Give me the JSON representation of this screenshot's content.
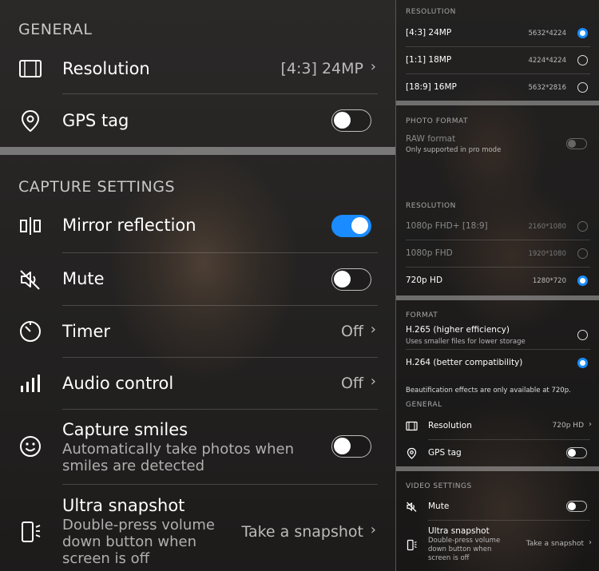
{
  "left": {
    "general_header": "GENERAL",
    "resolution": {
      "title": "Resolution",
      "value": "[4:3] 24MP",
      "chevron": "›"
    },
    "gps": {
      "title": "GPS tag",
      "on": false
    },
    "capture_header": "CAPTURE SETTINGS",
    "mirror": {
      "title": "Mirror reflection",
      "on": true
    },
    "mute": {
      "title": "Mute",
      "on": false
    },
    "timer": {
      "title": "Timer",
      "value": "Off",
      "chevron": "›"
    },
    "audio": {
      "title": "Audio control",
      "value": "Off",
      "chevron": "›"
    },
    "smiles": {
      "title": "Capture smiles",
      "subtitle": "Automatically take photos when smiles are detected",
      "on": false
    },
    "snapshot": {
      "title": "Ultra snapshot",
      "subtitle": "Double-press volume down button when screen is off",
      "value": "Take a snapshot",
      "chevron": "›"
    }
  },
  "right": {
    "photo_resolution_header": "RESOLUTION",
    "photo_resolutions": [
      {
        "label": "[4:3] 24MP",
        "dims": "5632*4224",
        "selected": true
      },
      {
        "label": "[1:1] 18MP",
        "dims": "4224*4224",
        "selected": false
      },
      {
        "label": "[18:9] 16MP",
        "dims": "5632*2816",
        "selected": false
      }
    ],
    "photo_format_header": "PHOTO FORMAT",
    "raw": {
      "label": "RAW format",
      "sub": "Only supported in pro mode"
    },
    "video_resolution_header": "RESOLUTION",
    "video_resolutions": [
      {
        "label": "1080p FHD+ [18:9]",
        "dims": "2160*1080",
        "selected": false,
        "disabled": true
      },
      {
        "label": "1080p FHD",
        "dims": "1920*1080",
        "selected": false,
        "disabled": true
      },
      {
        "label": "720p HD",
        "dims": "1280*720",
        "selected": true,
        "disabled": false
      }
    ],
    "format_header": "FORMAT",
    "formats": [
      {
        "label": "H.265 (higher efficiency)",
        "sub": "Uses smaller files for lower storage",
        "selected": false
      },
      {
        "label": "H.264 (better compatibility)",
        "sub": "",
        "selected": true
      }
    ],
    "beautification_note": "Beautification effects are only available at 720p.",
    "general_header": "GENERAL",
    "resolution": {
      "title": "Resolution",
      "value": "720p HD",
      "chevron": "›"
    },
    "gps": {
      "title": "GPS tag",
      "on": false
    },
    "video_settings_header": "VIDEO SETTINGS",
    "mute": {
      "title": "Mute",
      "on": false
    },
    "snapshot": {
      "title": "Ultra snapshot",
      "subtitle": "Double-press volume down button when screen is off",
      "value": "Take a snapshot",
      "chevron": "›"
    }
  },
  "colors": {
    "accent": "#1a8cff",
    "text": "#ffffff",
    "muted": "#b0b0b0"
  }
}
